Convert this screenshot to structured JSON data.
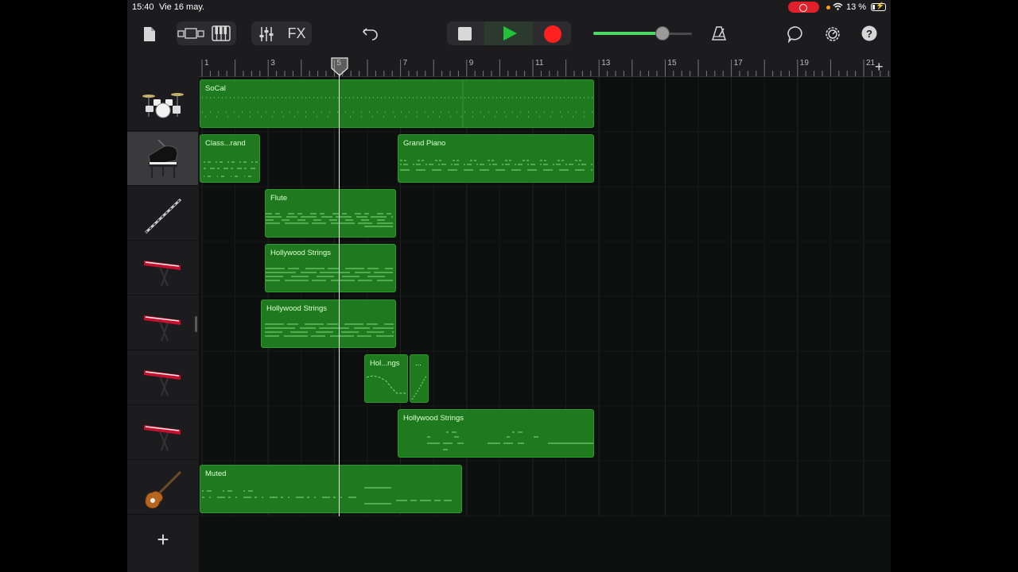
{
  "status_bar": {
    "time": "15:40",
    "date": "Vie 16 may.",
    "battery": "13 %"
  },
  "toolbar": {
    "fx_label": "FX",
    "master_volume": 0.7
  },
  "ruler": {
    "bars": [
      "1",
      "3",
      "5",
      "7",
      "9",
      "11",
      "13",
      "15",
      "17",
      "19",
      "21"
    ]
  },
  "tracks": [
    {
      "instrument": "drums-icon",
      "selected": false
    },
    {
      "instrument": "grand-piano-icon",
      "selected": true
    },
    {
      "instrument": "flute-icon",
      "selected": false
    },
    {
      "instrument": "keyboard-icon",
      "selected": false
    },
    {
      "instrument": "keyboard-icon",
      "selected": false
    },
    {
      "instrument": "keyboard-icon",
      "selected": false
    },
    {
      "instrument": "keyboard-icon",
      "selected": false
    },
    {
      "instrument": "bass-guitar-icon",
      "selected": false
    }
  ],
  "regions": {
    "socal": "SoCal",
    "classic_grand": "Class...rand",
    "grand_piano": "Grand Piano",
    "flute": "Flute",
    "hollywood_1": "Hollywood Strings",
    "hollywood_2": "Hollywood Strings",
    "hollywood_short": "Hol...ngs",
    "hollywood_tiny": "...",
    "hollywood_3": "Hollywood Strings",
    "muted": "Muted"
  },
  "colors": {
    "region_fill": "#1f7a1f",
    "play": "#22c33a",
    "record": "#ff2020"
  }
}
